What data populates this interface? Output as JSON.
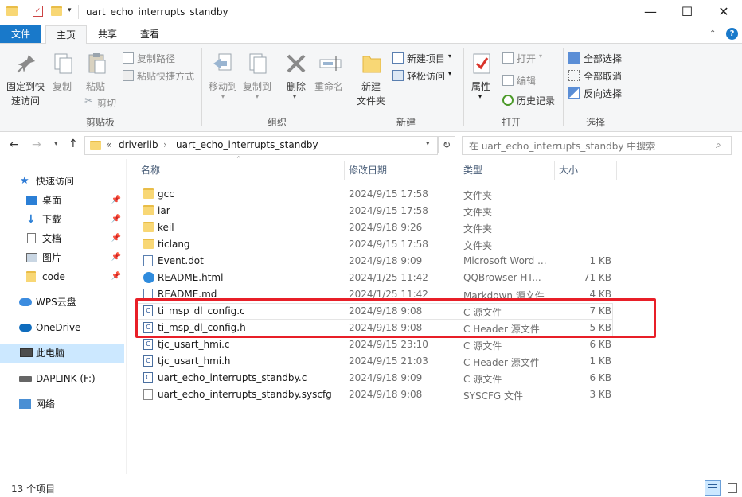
{
  "window": {
    "title": "uart_echo_interrupts_standby",
    "controls": {
      "minimize": "—",
      "maximize": "☐",
      "close": "✕"
    }
  },
  "ribbon_tabs": [
    "文件",
    "主页",
    "共享",
    "查看"
  ],
  "ribbon": {
    "clipboard": {
      "pin_label_1": "固定到快",
      "pin_label_2": "速访问",
      "copy": "复制",
      "paste": "粘贴",
      "copy_path": "复制路径",
      "paste_shortcut": "粘贴快捷方式",
      "cut": "剪切",
      "group": "剪贴板"
    },
    "organize": {
      "move_to": "移动到",
      "copy_to": "复制到",
      "delete": "删除",
      "rename": "重命名",
      "group": "组织"
    },
    "new": {
      "new_folder_1": "新建",
      "new_folder_2": "文件夹",
      "new_item": "新建项目",
      "easy_access": "轻松访问",
      "group": "新建"
    },
    "open": {
      "properties": "属性",
      "open": "打开",
      "edit": "编辑",
      "history": "历史记录",
      "group": "打开"
    },
    "select": {
      "select_all": "全部选择",
      "select_none": "全部取消",
      "invert": "反向选择",
      "group": "选择"
    }
  },
  "address": {
    "overflow": "«",
    "crumbs": [
      "driverlib",
      "uart_echo_interrupts_standby"
    ],
    "search_placeholder": "在 uart_echo_interrupts_standby 中搜索"
  },
  "nav": {
    "quick_access": "快速访问",
    "items": [
      "桌面",
      "下载",
      "文档",
      "图片",
      "code"
    ],
    "wps": "WPS云盘",
    "onedrive": "OneDrive",
    "this_pc": "此电脑",
    "daplink": "DAPLINK (F:)",
    "network": "网络"
  },
  "columns": {
    "name": "名称",
    "date": "修改日期",
    "type": "类型",
    "size": "大小"
  },
  "files": [
    {
      "name": "gcc",
      "date": "2024/9/15 17:58",
      "type": "文件夹",
      "size": "",
      "icon": "folder"
    },
    {
      "name": "iar",
      "date": "2024/9/15 17:58",
      "type": "文件夹",
      "size": "",
      "icon": "folder"
    },
    {
      "name": "keil",
      "date": "2024/9/18 9:26",
      "type": "文件夹",
      "size": "",
      "icon": "folder"
    },
    {
      "name": "ticlang",
      "date": "2024/9/15 17:58",
      "type": "文件夹",
      "size": "",
      "icon": "folder"
    },
    {
      "name": "Event.dot",
      "date": "2024/9/18 9:09",
      "type": "Microsoft Word ...",
      "size": "1 KB",
      "icon": "word"
    },
    {
      "name": "README.html",
      "date": "2024/1/25 11:42",
      "type": "QQBrowser HT...",
      "size": "71 KB",
      "icon": "browser"
    },
    {
      "name": "README.md",
      "date": "2024/1/25 11:42",
      "type": "Markdown 源文件",
      "size": "4 KB",
      "icon": "markdown"
    },
    {
      "name": "ti_msp_dl_config.c",
      "date": "2024/9/18 9:08",
      "type": "C 源文件",
      "size": "7 KB",
      "icon": "c"
    },
    {
      "name": "ti_msp_dl_config.h",
      "date": "2024/9/18 9:08",
      "type": "C Header 源文件",
      "size": "5 KB",
      "icon": "c"
    },
    {
      "name": "tjc_usart_hmi.c",
      "date": "2024/9/15 23:10",
      "type": "C 源文件",
      "size": "6 KB",
      "icon": "c"
    },
    {
      "name": "tjc_usart_hmi.h",
      "date": "2024/9/15 21:03",
      "type": "C Header 源文件",
      "size": "1 KB",
      "icon": "c"
    },
    {
      "name": "uart_echo_interrupts_standby.c",
      "date": "2024/9/18 9:09",
      "type": "C 源文件",
      "size": "6 KB",
      "icon": "c"
    },
    {
      "name": "uart_echo_interrupts_standby.syscfg",
      "date": "2024/9/18 9:08",
      "type": "SYSCFG 文件",
      "size": "3 KB",
      "icon": "file"
    }
  ],
  "status": "13 个项目",
  "colors": {
    "accent": "#1979ca",
    "highlight": "#e81f28",
    "selection": "#cce8ff"
  }
}
